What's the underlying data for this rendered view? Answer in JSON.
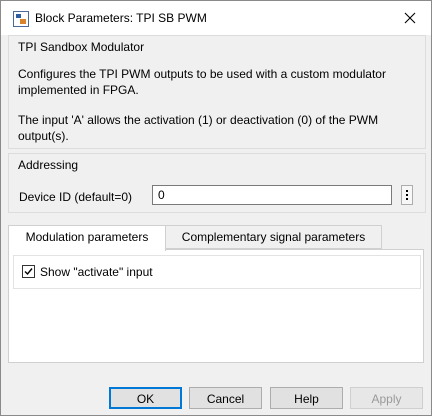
{
  "window": {
    "title": "Block Parameters: TPI SB PWM"
  },
  "description_group": {
    "title": "TPI Sandbox Modulator",
    "text1": "Configures the TPI PWM outputs to be used with a custom modulator implemented in FPGA.",
    "text2": "The input 'A' allows the activation (1) or deactivation (0) of the PWM output(s)."
  },
  "addressing": {
    "title": "Addressing",
    "device_id_label": "Device ID (default=0)",
    "device_id_value": "0"
  },
  "tabs": [
    {
      "label": "Modulation parameters",
      "active": true
    },
    {
      "label": "Complementary signal parameters",
      "active": false
    }
  ],
  "modulation": {
    "show_activate_label": "Show \"activate\" input",
    "show_activate_checked": true
  },
  "buttons": {
    "ok": "OK",
    "cancel": "Cancel",
    "help": "Help",
    "apply": "Apply"
  }
}
